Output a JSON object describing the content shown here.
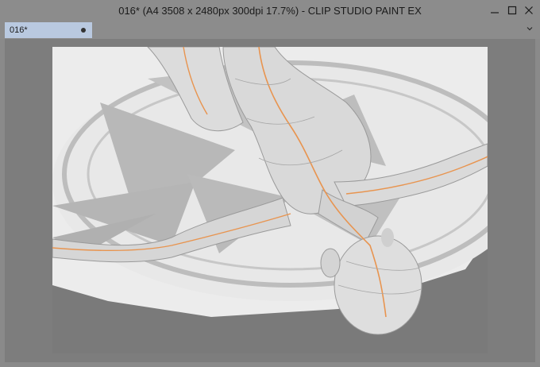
{
  "window": {
    "title": "016* (A4 3508 x 2480px 300dpi 17.7%)  - CLIP STUDIO PAINT EX",
    "minimize_icon": "minimize-icon",
    "maximize_icon": "maximize-icon",
    "close_icon": "close-icon"
  },
  "tabs": [
    {
      "label": "016*",
      "modified_icon": "dot-icon"
    }
  ],
  "tabbar": {
    "chevron_icon": "chevron-down-icon"
  },
  "canvas": {
    "subject": "3d-figure-on-patterned-platform"
  }
}
